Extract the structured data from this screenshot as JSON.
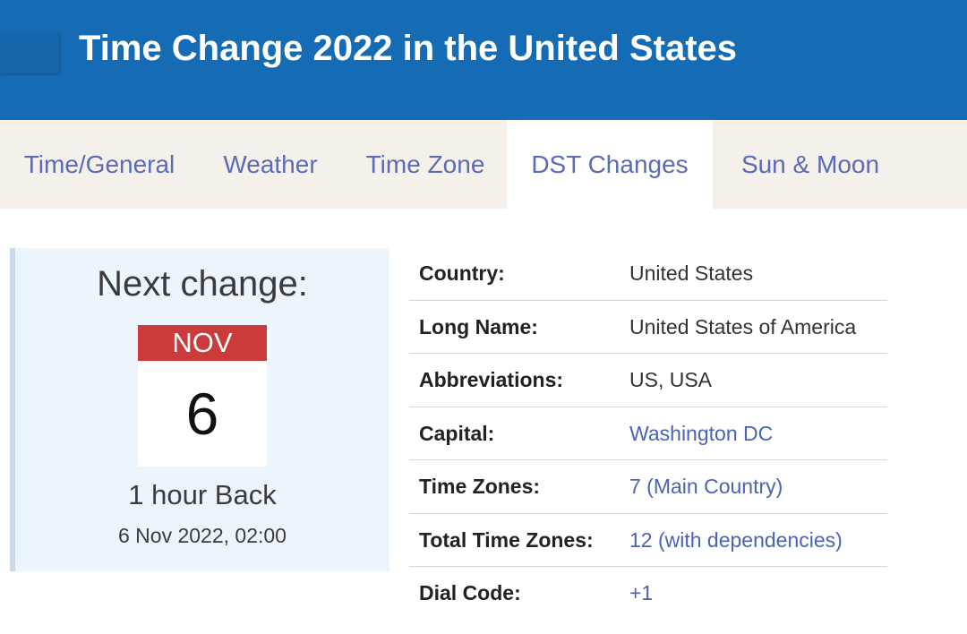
{
  "header": {
    "title": "Time Change 2022 in the United States"
  },
  "nav": {
    "items": [
      {
        "label": "Time/General"
      },
      {
        "label": "Weather"
      },
      {
        "label": "Time Zone"
      },
      {
        "label": "DST Changes"
      },
      {
        "label": "Sun & Moon"
      }
    ],
    "active": "DST Changes"
  },
  "next_change": {
    "title": "Next change:",
    "month": "NOV",
    "day": "6",
    "description": "1 hour Back",
    "datetime": "6 Nov 2022, 02:00"
  },
  "info": {
    "rows": [
      {
        "label": "Country:",
        "value": "United States"
      },
      {
        "label": "Long Name:",
        "value": "United States of America"
      },
      {
        "label": "Abbreviations:",
        "value": "US, USA"
      },
      {
        "label": "Capital:",
        "value": "Washington DC"
      },
      {
        "label": "Time Zones:",
        "value": "7 (Main Country)"
      },
      {
        "label": "Total Time Zones:",
        "value": "12 (with dependencies)"
      },
      {
        "label": "Dial Code:",
        "value": "+1"
      }
    ]
  },
  "colors": {
    "header_bg": "#156cb5",
    "nav_bg": "#f5f0e9",
    "link": "#4a63b5",
    "calendar_month_bg": "#cb3b3b",
    "panel_bg": "#edf5fc"
  }
}
